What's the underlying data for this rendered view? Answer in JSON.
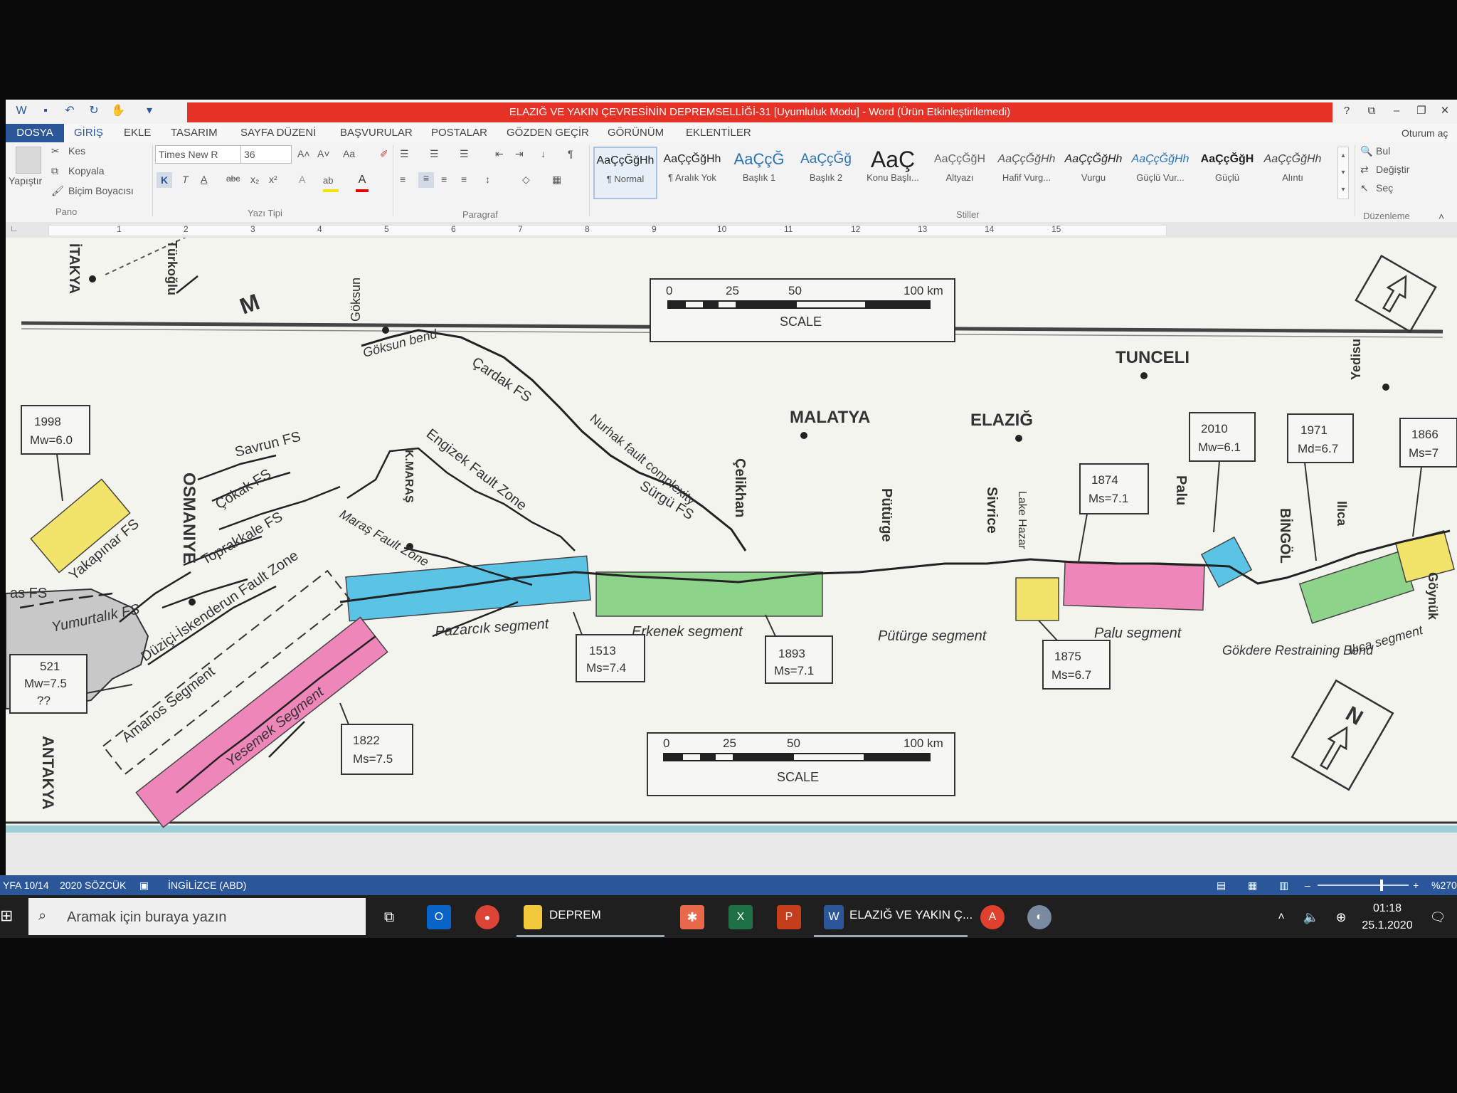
{
  "window": {
    "title": "ELAZIĞ VE YAKIN ÇEVRESİNİN DEPREMSELLİĞİ-31 [Uyumluluk Modu] - Word (Ürün Etkinleştirilemedi)",
    "help": "?",
    "signin": "Oturum aç"
  },
  "menu": [
    "DOSYA",
    "GİRİŞ",
    "EKLE",
    "TASARIM",
    "SAYFA DÜZENİ",
    "BAŞVURULAR",
    "POSTALAR",
    "GÖZDEN GEÇİR",
    "GÖRÜNÜM",
    "EKLENTİLER"
  ],
  "ribbon": {
    "paste": "Yapıştır",
    "cut": "Kes",
    "copy": "Kopyala",
    "format_painter": "Biçim Boyacısı",
    "group_clipboard": "Pano",
    "font_name": "Times New R",
    "font_size": "36",
    "group_font": "Yazı Tipi",
    "group_paragraph": "Paragraf",
    "group_styles": "Stiller",
    "group_editing": "Düzenleme",
    "find": "Bul",
    "replace": "Değiştir",
    "select": "Seç",
    "case_label": "Aa",
    "bold": "K",
    "italic": "T",
    "underline": "A",
    "strike": "abc",
    "subscript": "x₂",
    "superscript": "x²",
    "styles": [
      {
        "preview": "AaÇçĞğHh",
        "name": "¶ Normal"
      },
      {
        "preview": "AaÇçĞğHh",
        "name": "¶ Aralık Yok"
      },
      {
        "preview": "AaÇçĞ",
        "name": "Başlık 1"
      },
      {
        "preview": "AaÇçĞğ",
        "name": "Başlık 2"
      },
      {
        "preview": "AaÇ",
        "name": "Konu Başlı..."
      },
      {
        "preview": "AaÇçĞğH",
        "name": "Altyazı"
      },
      {
        "preview": "AaÇçĞğHh",
        "name": "Hafif Vurg..."
      },
      {
        "preview": "AaÇçĞğHh",
        "name": "Vurgu"
      },
      {
        "preview": "AaÇçĞğHh",
        "name": "Güçlü Vur..."
      },
      {
        "preview": "AaÇçĞğH",
        "name": "Güçlü"
      },
      {
        "preview": "AaÇçĞğHh",
        "name": "Alıntı"
      }
    ]
  },
  "ruler": [
    "1",
    "2",
    "3",
    "4",
    "5",
    "6",
    "7",
    "8",
    "9",
    "10",
    "11",
    "12",
    "13",
    "14",
    "15"
  ],
  "map": {
    "scale_top": {
      "ticks": [
        "0",
        "25",
        "50",
        "100 km"
      ],
      "label": "SCALE"
    },
    "scale_bottom": {
      "ticks": [
        "0",
        "25",
        "50",
        "100 km"
      ],
      "label": "SCALE"
    },
    "north": "N",
    "cities": [
      "TUNCELI",
      "MALATYA",
      "ELAZIĞ",
      "OSMANIYE",
      "ANTAKYA",
      "İTAKYA",
      "BİNGÖL"
    ],
    "places": [
      "Göksun",
      "Göksun bend",
      "Çelikhan",
      "Pütürge",
      "Sivrice",
      "Lake Hazar",
      "Palu",
      "Ilıca",
      "Yedisu",
      "Göynük",
      "K.MARAŞ",
      "Türkoğlu"
    ],
    "faults": [
      "Savrun FS",
      "Çokak FS",
      "Toprakkale FS",
      "Maraş Fault Zone",
      "Engizek Fault Zone",
      "Çardak FS",
      "Nurhak fault complexity",
      "Sürgü FS",
      "Yakapınar FS",
      "Düziçi-İskenderun Fault Zone",
      "Yumurtalık FS",
      "Amanos Segment",
      "Yesemek Segment",
      "Pazarcık segment",
      "Erkenek segment",
      "Pütürge segment",
      "Palu segment",
      "Gökdere Restraining Bend",
      "Ilıca segment",
      "M",
      "as FS"
    ],
    "events": [
      {
        "year": "1998",
        "mag": "Mw=6.0"
      },
      {
        "year": "521",
        "mag": "Mw=7.5",
        "note": "??"
      },
      {
        "year": "1822",
        "mag": "Ms=7.5"
      },
      {
        "year": "1513",
        "mag": "Ms=7.4"
      },
      {
        "year": "1893",
        "mag": "Ms=7.1"
      },
      {
        "year": "1874",
        "mag": "Ms=7.1"
      },
      {
        "year": "1875",
        "mag": "Ms=6.7"
      },
      {
        "year": "2010",
        "mag": "Mw=6.1"
      },
      {
        "year": "1971",
        "mag": "Md=6.7"
      },
      {
        "year": "1866",
        "mag": "Ms=7"
      }
    ]
  },
  "status": {
    "page": "YFA 10/14",
    "words": "2020 SÖZCÜK",
    "language": "İNGİLİZCE (ABD)",
    "zoom": "%270"
  },
  "taskbar": {
    "search_placeholder": "Aramak için buraya yazın",
    "explorer": "DEPREM",
    "word": "ELAZIĞ VE YAKIN Ç...",
    "time": "01:18",
    "date": "25.1.2020"
  }
}
